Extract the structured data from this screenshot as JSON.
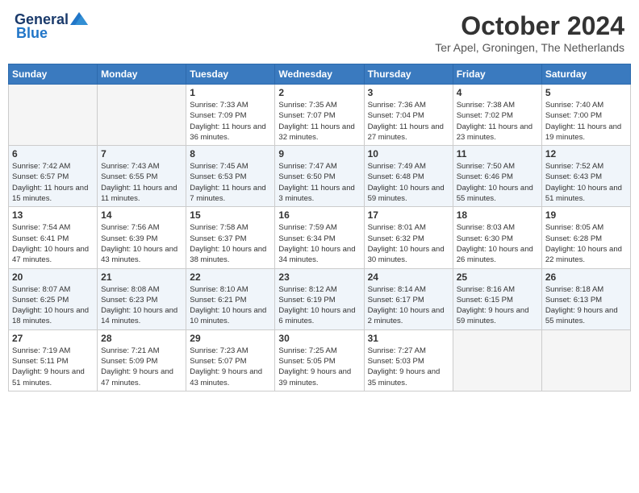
{
  "header": {
    "logo_line1": "General",
    "logo_line2": "Blue",
    "month_title": "October 2024",
    "location": "Ter Apel, Groningen, The Netherlands"
  },
  "weekdays": [
    "Sunday",
    "Monday",
    "Tuesday",
    "Wednesday",
    "Thursday",
    "Friday",
    "Saturday"
  ],
  "weeks": [
    [
      {
        "day": "",
        "info": ""
      },
      {
        "day": "",
        "info": ""
      },
      {
        "day": "1",
        "info": "Sunrise: 7:33 AM\nSunset: 7:09 PM\nDaylight: 11 hours and 36 minutes."
      },
      {
        "day": "2",
        "info": "Sunrise: 7:35 AM\nSunset: 7:07 PM\nDaylight: 11 hours and 32 minutes."
      },
      {
        "day": "3",
        "info": "Sunrise: 7:36 AM\nSunset: 7:04 PM\nDaylight: 11 hours and 27 minutes."
      },
      {
        "day": "4",
        "info": "Sunrise: 7:38 AM\nSunset: 7:02 PM\nDaylight: 11 hours and 23 minutes."
      },
      {
        "day": "5",
        "info": "Sunrise: 7:40 AM\nSunset: 7:00 PM\nDaylight: 11 hours and 19 minutes."
      }
    ],
    [
      {
        "day": "6",
        "info": "Sunrise: 7:42 AM\nSunset: 6:57 PM\nDaylight: 11 hours and 15 minutes."
      },
      {
        "day": "7",
        "info": "Sunrise: 7:43 AM\nSunset: 6:55 PM\nDaylight: 11 hours and 11 minutes."
      },
      {
        "day": "8",
        "info": "Sunrise: 7:45 AM\nSunset: 6:53 PM\nDaylight: 11 hours and 7 minutes."
      },
      {
        "day": "9",
        "info": "Sunrise: 7:47 AM\nSunset: 6:50 PM\nDaylight: 11 hours and 3 minutes."
      },
      {
        "day": "10",
        "info": "Sunrise: 7:49 AM\nSunset: 6:48 PM\nDaylight: 10 hours and 59 minutes."
      },
      {
        "day": "11",
        "info": "Sunrise: 7:50 AM\nSunset: 6:46 PM\nDaylight: 10 hours and 55 minutes."
      },
      {
        "day": "12",
        "info": "Sunrise: 7:52 AM\nSunset: 6:43 PM\nDaylight: 10 hours and 51 minutes."
      }
    ],
    [
      {
        "day": "13",
        "info": "Sunrise: 7:54 AM\nSunset: 6:41 PM\nDaylight: 10 hours and 47 minutes."
      },
      {
        "day": "14",
        "info": "Sunrise: 7:56 AM\nSunset: 6:39 PM\nDaylight: 10 hours and 43 minutes."
      },
      {
        "day": "15",
        "info": "Sunrise: 7:58 AM\nSunset: 6:37 PM\nDaylight: 10 hours and 38 minutes."
      },
      {
        "day": "16",
        "info": "Sunrise: 7:59 AM\nSunset: 6:34 PM\nDaylight: 10 hours and 34 minutes."
      },
      {
        "day": "17",
        "info": "Sunrise: 8:01 AM\nSunset: 6:32 PM\nDaylight: 10 hours and 30 minutes."
      },
      {
        "day": "18",
        "info": "Sunrise: 8:03 AM\nSunset: 6:30 PM\nDaylight: 10 hours and 26 minutes."
      },
      {
        "day": "19",
        "info": "Sunrise: 8:05 AM\nSunset: 6:28 PM\nDaylight: 10 hours and 22 minutes."
      }
    ],
    [
      {
        "day": "20",
        "info": "Sunrise: 8:07 AM\nSunset: 6:25 PM\nDaylight: 10 hours and 18 minutes."
      },
      {
        "day": "21",
        "info": "Sunrise: 8:08 AM\nSunset: 6:23 PM\nDaylight: 10 hours and 14 minutes."
      },
      {
        "day": "22",
        "info": "Sunrise: 8:10 AM\nSunset: 6:21 PM\nDaylight: 10 hours and 10 minutes."
      },
      {
        "day": "23",
        "info": "Sunrise: 8:12 AM\nSunset: 6:19 PM\nDaylight: 10 hours and 6 minutes."
      },
      {
        "day": "24",
        "info": "Sunrise: 8:14 AM\nSunset: 6:17 PM\nDaylight: 10 hours and 2 minutes."
      },
      {
        "day": "25",
        "info": "Sunrise: 8:16 AM\nSunset: 6:15 PM\nDaylight: 9 hours and 59 minutes."
      },
      {
        "day": "26",
        "info": "Sunrise: 8:18 AM\nSunset: 6:13 PM\nDaylight: 9 hours and 55 minutes."
      }
    ],
    [
      {
        "day": "27",
        "info": "Sunrise: 7:19 AM\nSunset: 5:11 PM\nDaylight: 9 hours and 51 minutes."
      },
      {
        "day": "28",
        "info": "Sunrise: 7:21 AM\nSunset: 5:09 PM\nDaylight: 9 hours and 47 minutes."
      },
      {
        "day": "29",
        "info": "Sunrise: 7:23 AM\nSunset: 5:07 PM\nDaylight: 9 hours and 43 minutes."
      },
      {
        "day": "30",
        "info": "Sunrise: 7:25 AM\nSunset: 5:05 PM\nDaylight: 9 hours and 39 minutes."
      },
      {
        "day": "31",
        "info": "Sunrise: 7:27 AM\nSunset: 5:03 PM\nDaylight: 9 hours and 35 minutes."
      },
      {
        "day": "",
        "info": ""
      },
      {
        "day": "",
        "info": ""
      }
    ]
  ]
}
